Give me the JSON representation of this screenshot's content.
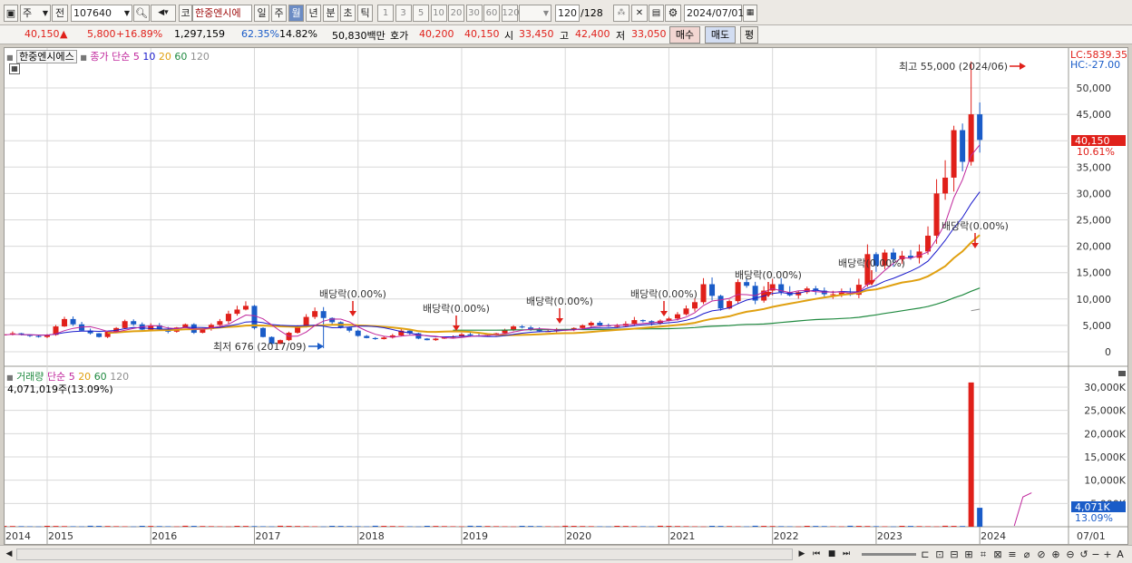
{
  "toolbar": {
    "period_mode": "주",
    "prev_label": "전",
    "stock_code": "107640",
    "market_badge": "코",
    "stock_name": "한중엔시에",
    "periods": [
      "일",
      "주",
      "월",
      "년",
      "분",
      "초",
      "틱"
    ],
    "active_period": "월",
    "intervals": [
      "1",
      "3",
      "5",
      "10",
      "20",
      "30",
      "60",
      "120"
    ],
    "count_value": "120",
    "count_total": "/128",
    "date": "2024/07/01"
  },
  "quote": {
    "price": "40,150",
    "change_arrow": "▲",
    "change": "5,800",
    "change_pct": "+16.89%",
    "volume": "1,297,159",
    "ratio1": "62.35%",
    "ratio2": "14.82%",
    "amount": "50,830백만",
    "bid_label": "호가",
    "bid1": "40,200",
    "bid2": "40,150",
    "open_label": "시",
    "open": "33,450",
    "high_label": "고",
    "high": "42,400",
    "low_label": "저",
    "low": "33,050",
    "buy_label": "매수",
    "sell_label": "매도",
    "eval_label": "평"
  },
  "price_panel": {
    "legend_name": "한중엔시에스",
    "legend_type": "종가 단순",
    "ma_labels": [
      "5",
      "10",
      "20",
      "60",
      "120"
    ],
    "ma_colors": [
      "#c0269c",
      "#1a1acc",
      "#e0a010",
      "#208a40",
      "#909090"
    ],
    "lc_label": "LC:5839.35",
    "hc_label": "HC:-27.00",
    "current_price_tag": "40,150",
    "current_pct_tag": "10.61%",
    "high_annotation": "최고 55,000 (2024/06)",
    "low_annotation": "최저 676 (2017/09)",
    "dividend_label": "배당락(0.00%)",
    "y_ticks": [
      "50,000",
      "45,000",
      "40,000",
      "35,000",
      "30,000",
      "25,000",
      "20,000",
      "15,000",
      "10,000",
      "5,000",
      "0"
    ]
  },
  "volume_panel": {
    "legend_name": "거래량",
    "legend_type": "단순",
    "ma_labels": [
      "5",
      "20",
      "60",
      "120"
    ],
    "current_volume": "4,071,019주(13.09%)",
    "current_volume_tag": "4,071K",
    "current_volume_pct_tag": "13.09%",
    "y_ticks": [
      "30,000K",
      "25,000K",
      "20,000K",
      "15,000K",
      "10,000K",
      "5,000K"
    ]
  },
  "x_axis": {
    "labels": [
      "2014",
      "2015",
      "2016",
      "2017",
      "2018",
      "2019",
      "2020",
      "2021",
      "2022",
      "2023",
      "2024"
    ],
    "right_label": "07/01"
  },
  "colors": {
    "up": "#e0201a",
    "down": "#1a5cc8",
    "grid": "#d8d8d8"
  },
  "chart_data": {
    "type": "candlestick",
    "period": "monthly",
    "high": {
      "value": 55000,
      "date": "2024/06"
    },
    "low": {
      "value": 676,
      "date": "2017/09"
    },
    "latest_close": 40150,
    "latest_volume": 4071019,
    "price_ylim": [
      0,
      55000
    ],
    "volume_ylim": [
      0,
      32000000
    ],
    "recent_closes": [
      {
        "date": "2023/08",
        "close": 19000
      },
      {
        "date": "2023/11",
        "close": 18500
      },
      {
        "date": "2024/01",
        "close": 22000
      },
      {
        "date": "2024/02",
        "close": 30000
      },
      {
        "date": "2024/03",
        "close": 33000
      },
      {
        "date": "2024/04",
        "close": 42000
      },
      {
        "date": "2024/05",
        "close": 36000
      },
      {
        "date": "2024/06",
        "close": 45000
      },
      {
        "date": "2024/07",
        "close": 40150
      }
    ]
  }
}
